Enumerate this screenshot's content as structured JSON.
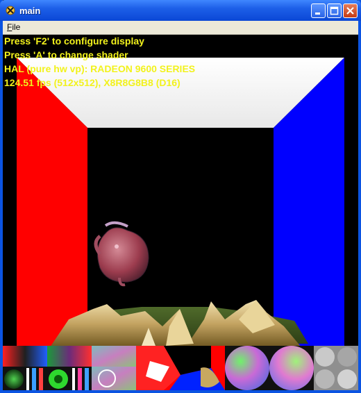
{
  "window": {
    "title": "main"
  },
  "menu": {
    "file_label": "File"
  },
  "hud": {
    "line1": "Press 'F2' to configure display",
    "line2": "Press 'A' to change shader",
    "line3": "HAL (pure hw vp): RADEON 9600 SERIES",
    "line4": "124.51 fps (512x512), X8R8G8B8 (D16)"
  },
  "colors": {
    "titlebar": "#0b54e2",
    "hud_text": "#f2f21c",
    "wall_left": "#ff0000",
    "wall_right": "#0000ff",
    "ceiling": "#ffffff",
    "menubar": "#ece9d8"
  },
  "icons": {
    "app": "app-icon",
    "minimize": "minimize-icon",
    "maximize": "maximize-icon",
    "close": "close-icon"
  }
}
